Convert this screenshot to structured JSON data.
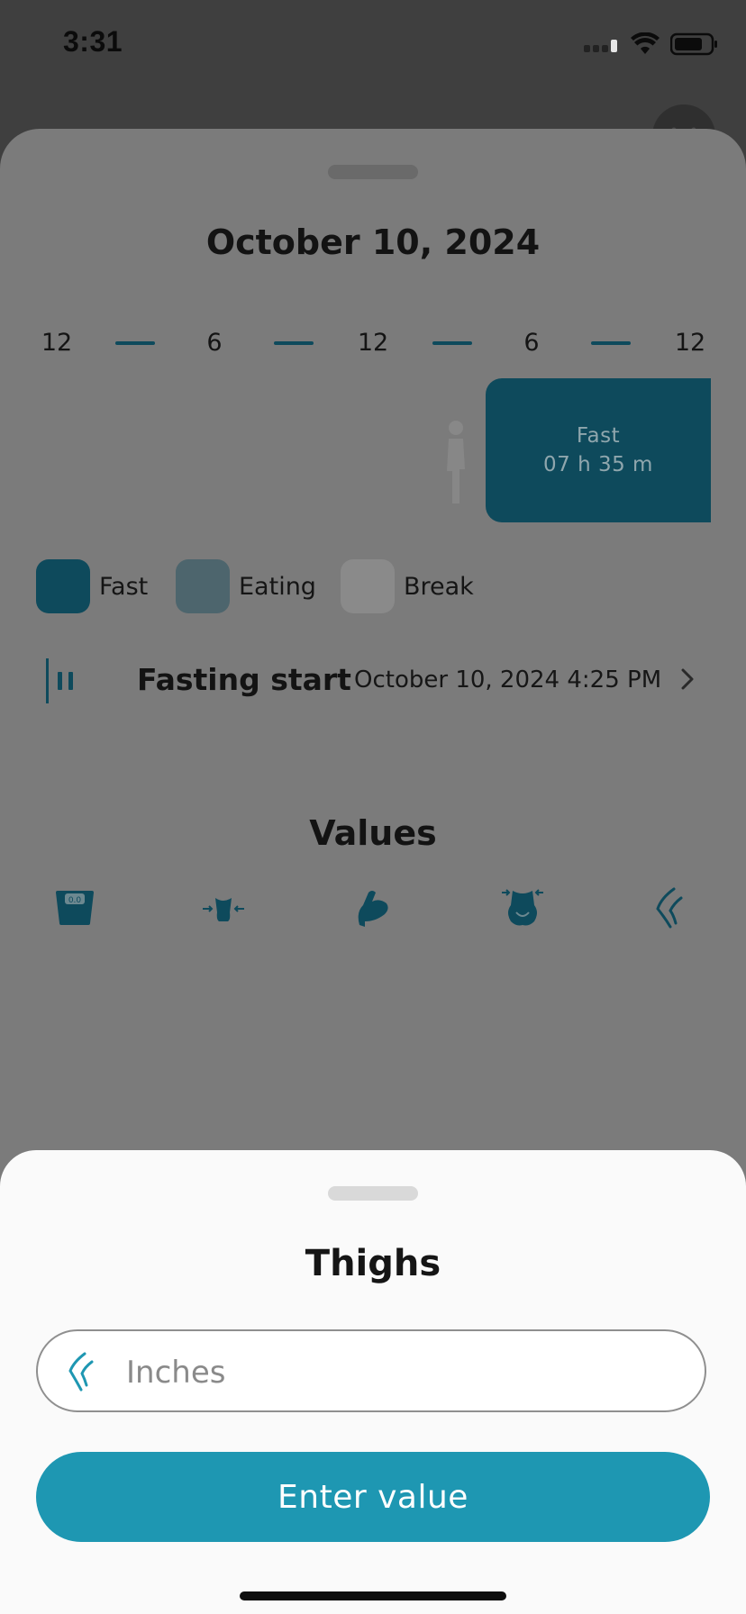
{
  "status_bar": {
    "time": "3:31"
  },
  "background_sheet": {
    "date_title": "October 10, 2024",
    "timeline_hours": [
      "12",
      "6",
      "12",
      "6",
      "12"
    ],
    "fast_block": {
      "label": "Fast",
      "duration": "07 h 35 m"
    },
    "legend": [
      {
        "label": "Fast",
        "color": "#0e4a5c"
      },
      {
        "label": "Eating",
        "color": "#4d656d"
      },
      {
        "label": "Break",
        "color": "#8a8a8a"
      }
    ],
    "fasting_start": {
      "label": "Fasting start",
      "value": "October 10, 2024 4:25 PM"
    },
    "values_title": "Values",
    "value_icons": [
      "scale-icon",
      "waist-icon",
      "biceps-icon",
      "hips-icon",
      "thighs-icon"
    ]
  },
  "thighs_sheet": {
    "title": "Thighs",
    "input": {
      "placeholder": "Inches",
      "value": ""
    },
    "button_label": "Enter value"
  },
  "colors": {
    "accent": "#1e97b2",
    "dark_teal": "#0e4a5c"
  }
}
